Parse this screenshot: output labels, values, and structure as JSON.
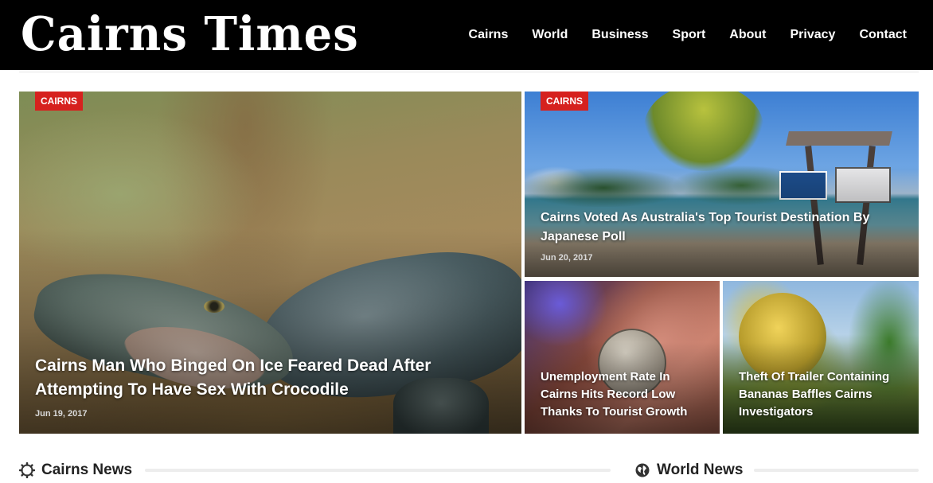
{
  "site": {
    "title": "Cairns Times"
  },
  "nav": {
    "items": [
      "Cairns",
      "World",
      "Business",
      "Sport",
      "About",
      "Privacy",
      "Contact"
    ]
  },
  "featured": [
    {
      "category": "CAIRNS",
      "title": "Cairns Man Who Binged On Ice Feared Dead After Attempting To Have Sex With Crocodile",
      "date": "Jun 19, 2017"
    },
    {
      "category": "CAIRNS",
      "title": "Cairns Voted As Australia's Top Tourist Destination By Japanese Poll",
      "date": "Jun 20, 2017"
    },
    {
      "title": "Unemployment Rate In Cairns Hits Record Low Thanks To Tourist Growth"
    },
    {
      "title": "Theft Of Trailer Containing Bananas Baffles Cairns Investigators"
    }
  ],
  "sections": [
    {
      "title": "Cairns News",
      "icon": "gear-icon"
    },
    {
      "title": "World News",
      "icon": "globe-icon"
    }
  ],
  "colors": {
    "header_bg": "#000000",
    "badge_red": "#d6211e",
    "text_dark": "#222222"
  }
}
